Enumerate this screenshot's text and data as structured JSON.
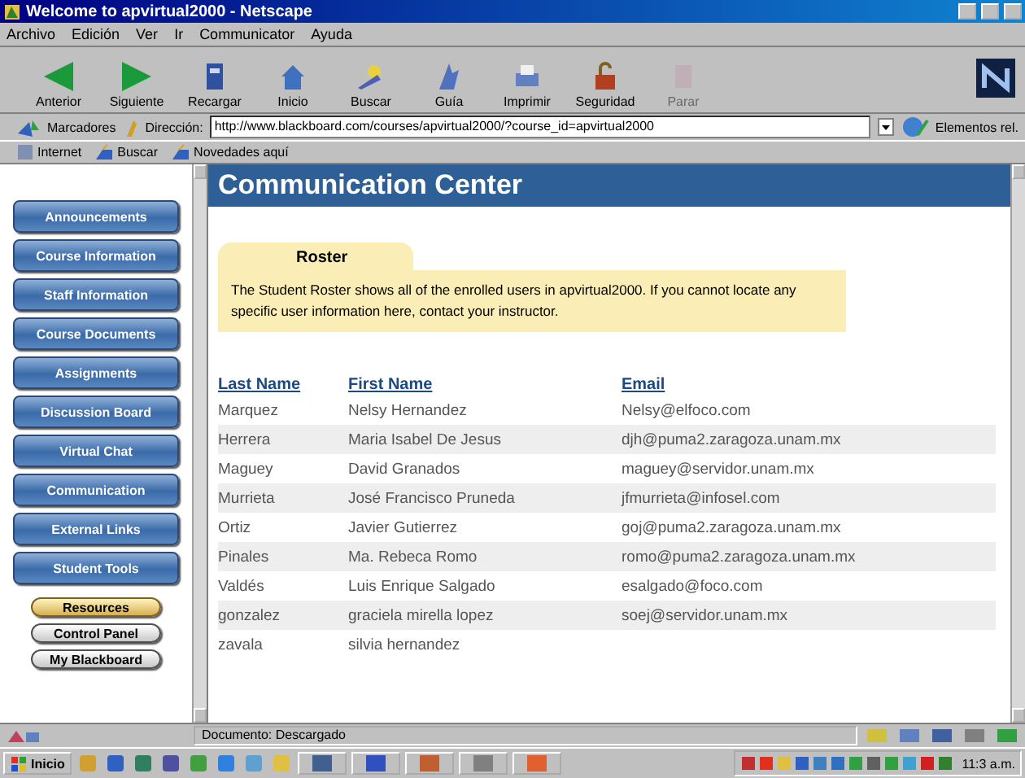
{
  "window": {
    "title": "Welcome to apvirtual2000 - Netscape"
  },
  "menu": [
    "Archivo",
    "Edición",
    "Ver",
    "Ir",
    "Communicator",
    "Ayuda"
  ],
  "toolbar": [
    {
      "label": "Anterior",
      "disabled": false
    },
    {
      "label": "Siguiente",
      "disabled": false
    },
    {
      "label": "Recargar",
      "disabled": false
    },
    {
      "label": "Inicio",
      "disabled": false
    },
    {
      "label": "Buscar",
      "disabled": false
    },
    {
      "label": "Guía",
      "disabled": false
    },
    {
      "label": "Imprimir",
      "disabled": false
    },
    {
      "label": "Seguridad",
      "disabled": false
    },
    {
      "label": "Parar",
      "disabled": true
    }
  ],
  "location": {
    "bookmarks": "Marcadores",
    "address_label": "Dirección:",
    "url": "http://www.blackboard.com/courses/apvirtual2000/?course_id=apvirtual2000",
    "related": "Elementos rel."
  },
  "personal_toolbar": [
    "Internet",
    "Buscar",
    "Novedades aquí"
  ],
  "sidebar": [
    {
      "label": "Announcements",
      "kind": "main"
    },
    {
      "label": "Course Information",
      "kind": "main"
    },
    {
      "label": "Staff Information",
      "kind": "main"
    },
    {
      "label": "Course Documents",
      "kind": "main"
    },
    {
      "label": "Assignments",
      "kind": "main"
    },
    {
      "label": "Discussion Board",
      "kind": "main"
    },
    {
      "label": "Virtual Chat",
      "kind": "main"
    },
    {
      "label": "Communication",
      "kind": "main"
    },
    {
      "label": "External Links",
      "kind": "main"
    },
    {
      "label": "Student Tools",
      "kind": "main"
    },
    {
      "label": "Resources",
      "kind": "gold"
    },
    {
      "label": "Control Panel",
      "kind": "plain"
    },
    {
      "label": "My Blackboard",
      "kind": "plain"
    }
  ],
  "page": {
    "header": "Communication Center",
    "roster": {
      "tab": "Roster",
      "text": "The Student Roster shows all of the enrolled users in apvirtual2000. If you cannot locate any specific user information here, contact your instructor."
    },
    "columns": [
      "Last Name",
      "First Name",
      "Email"
    ],
    "rows": [
      {
        "last": "Marquez",
        "first": "Nelsy Hernandez",
        "email": "Nelsy@elfoco.com"
      },
      {
        "last": "Herrera",
        "first": "Maria Isabel De Jesus",
        "email": "djh@puma2.zaragoza.unam.mx"
      },
      {
        "last": "Maguey",
        "first": "David Granados",
        "email": "maguey@servidor.unam.mx"
      },
      {
        "last": "Murrieta",
        "first": "José Francisco Pruneda",
        "email": "jfmurrieta@infosel.com"
      },
      {
        "last": "Ortiz",
        "first": "Javier Gutierrez",
        "email": "goj@puma2.zaragoza.unam.mx"
      },
      {
        "last": "Pinales",
        "first": "Ma. Rebeca Romo",
        "email": "romo@puma2.zaragoza.unam.mx"
      },
      {
        "last": "Valdés",
        "first": "Luis Enrique Salgado",
        "email": "esalgado@foco.com"
      },
      {
        "last": "gonzalez",
        "first": "graciela mirella lopez",
        "email": "soej@servidor.unam.mx"
      },
      {
        "last": "zavala",
        "first": "silvia hernandez"
      }
    ]
  },
  "status_bar": {
    "text": "Documento: Descargado"
  },
  "taskbar": {
    "start": "Inicio",
    "clock": "11:3 a.m."
  }
}
